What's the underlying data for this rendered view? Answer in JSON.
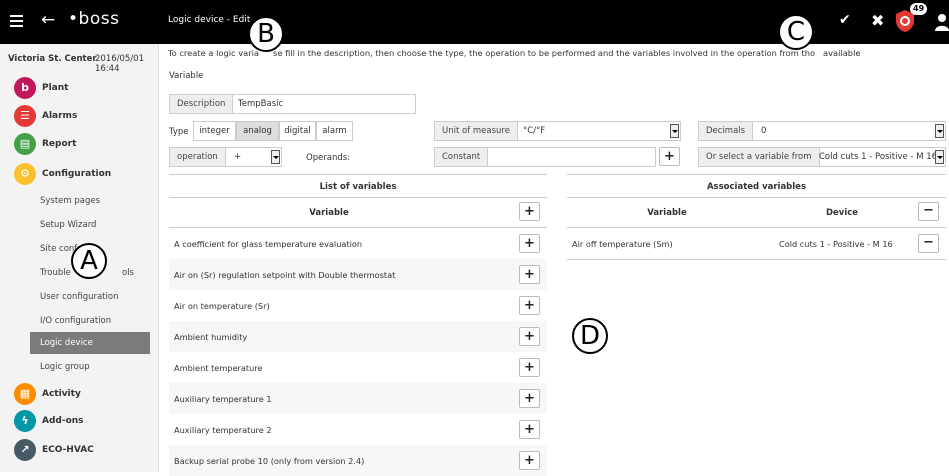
{
  "topbar": {
    "logo": "boss",
    "title": "Logic device - Edit",
    "badge_count": "49",
    "icons": [
      "menu-icon",
      "back-icon",
      "check-icon",
      "close-icon",
      "shield-alarm-icon",
      "user-icon"
    ]
  },
  "callouts": {
    "a": "A",
    "b": "B",
    "c": "C",
    "d": "D"
  },
  "sidebar": {
    "site": "Victoria St. Center",
    "datetime": "2016/05/01 16:44",
    "sections": [
      {
        "label": "Plant",
        "color": "#c2185b",
        "icon": "plant-icon"
      },
      {
        "label": "Alarms",
        "color": "#e53935",
        "icon": "alarms-icon"
      },
      {
        "label": "Report",
        "color": "#43a047",
        "icon": "report-icon"
      },
      {
        "label": "Configuration",
        "color": "#fbc02d",
        "icon": "configuration-icon"
      },
      {
        "label": "Activity",
        "color": "#fb8c00",
        "icon": "activity-icon"
      },
      {
        "label": "Add-ons",
        "color": "#0097a7",
        "icon": "add-ons-icon"
      },
      {
        "label": "ECO-HVAC",
        "color": "#455a64",
        "icon": "eco-hvac-icon"
      }
    ],
    "config_items": [
      "System pages",
      "Setup Wizard",
      "Site conf",
      "Trouble",
      "ols",
      "User configuration",
      "I/O configuration",
      "Logic device",
      "Logic group"
    ],
    "active_item": "Logic device"
  },
  "main": {
    "instructions_pre": "To create a logic varia",
    "instructions_post": "se fill in the description, then choose the type, the operation to be performed and the variables involved in the operation from tho",
    "instructions_tail": "available",
    "section_label": "Variable",
    "description": {
      "label": "Description",
      "value": "TempBasic"
    },
    "type_label": "Type",
    "types": [
      "integer",
      "analog",
      "digital",
      "alarm"
    ],
    "selected_type": "analog",
    "unit": {
      "label": "Unit of measure",
      "value": "°C/°F"
    },
    "decimals": {
      "label": "Decimals",
      "value": "0"
    },
    "operation": {
      "label": "operation",
      "value": "+"
    },
    "operands_label": "Operands:",
    "constant": {
      "label": "Constant",
      "value": ""
    },
    "select_variable": {
      "label": "Or select a variable from",
      "value": "Cold cuts 1 - Positive - M 16"
    }
  },
  "list_of_variables": {
    "title": "List of variables",
    "column": "Variable",
    "rows": [
      "A coefficient for glass temperature evaluation",
      "Air on (Sr) regulation setpoint with Double thermostat",
      "Air on temperature (Sr)",
      "Ambient humidity",
      "Ambient temperature",
      "Auxiliary temperature 1",
      "Auxiliary temperature 2",
      "Backup serial probe 10 (only from version 2.4)"
    ]
  },
  "associated_variables": {
    "title": "Associated variables",
    "columns": [
      "Variable",
      "Device"
    ],
    "rows": [
      {
        "variable": "Air off temperature (Sm)",
        "device": "Cold cuts 1 - Positive - M 16"
      }
    ]
  }
}
